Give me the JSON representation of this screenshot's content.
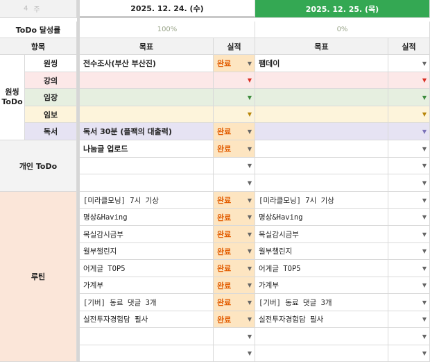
{
  "top_left": {
    "row_label": "4",
    "week_label": "주"
  },
  "dates": [
    "2025. 12. 24. (수)",
    "2025. 12. 25. (목)"
  ],
  "rate_label": "ToDo 달성률",
  "rates": [
    "100%",
    "0%"
  ],
  "headers": {
    "item": "항목",
    "goal": "목표",
    "result": "실적"
  },
  "groups": {
    "onssing": "원씽\nToDo",
    "personal": "개인 ToDo",
    "routine": "루틴"
  },
  "onssing_rows": [
    {
      "label": "원씽",
      "d1_goal": "전수조사(부산 부산진)",
      "d1_result": "완료",
      "d2_goal": "팸데이",
      "d2_result": ""
    },
    {
      "label": "강의",
      "d1_goal": "",
      "d1_result": "",
      "d2_goal": "",
      "d2_result": ""
    },
    {
      "label": "임장",
      "d1_goal": "",
      "d1_result": "",
      "d2_goal": "",
      "d2_result": ""
    },
    {
      "label": "임보",
      "d1_goal": "",
      "d1_result": "",
      "d2_goal": "",
      "d2_result": ""
    },
    {
      "label": "독서",
      "d1_goal": "독서 30분 (플팩의 대출력)",
      "d1_result": "완료",
      "d2_goal": "",
      "d2_result": ""
    }
  ],
  "personal_rows": [
    {
      "d1_goal": "나눔글 업로드",
      "d1_result": "완료",
      "d2_goal": "",
      "d2_result": ""
    },
    {
      "d1_goal": "",
      "d1_result": "",
      "d2_goal": "",
      "d2_result": ""
    },
    {
      "d1_goal": "",
      "d1_result": "",
      "d2_goal": "",
      "d2_result": ""
    }
  ],
  "routine_rows": [
    {
      "d1_goal": "[미라클모닝] 7시 기상",
      "d1_result": "완료",
      "d2_goal": "[미라클모닝] 7시 기상",
      "d2_result": ""
    },
    {
      "d1_goal": "명상&Having",
      "d1_result": "완료",
      "d2_goal": "명상&Having",
      "d2_result": ""
    },
    {
      "d1_goal": "목실감시금부",
      "d1_result": "완료",
      "d2_goal": "목실감시금부",
      "d2_result": ""
    },
    {
      "d1_goal": "월부챌린지",
      "d1_result": "완료",
      "d2_goal": "월부챌린지",
      "d2_result": ""
    },
    {
      "d1_goal": "어게글 TOP5",
      "d1_result": "완료",
      "d2_goal": "어게글 TOP5",
      "d2_result": ""
    },
    {
      "d1_goal": "가계부",
      "d1_result": "완료",
      "d2_goal": "가계부",
      "d2_result": ""
    },
    {
      "d1_goal": "[기버] 동료 댓글 3개",
      "d1_result": "완료",
      "d2_goal": "[기버] 동료 댓글 3개",
      "d2_result": ""
    },
    {
      "d1_goal": "실전투자경험담 필사",
      "d1_result": "완료",
      "d2_goal": "실전투자경험담 필사",
      "d2_result": ""
    },
    {
      "d1_goal": "",
      "d1_result": "",
      "d2_goal": "",
      "d2_result": ""
    },
    {
      "d1_goal": "",
      "d1_result": "",
      "d2_goal": "",
      "d2_result": ""
    }
  ],
  "colors": {
    "date2_header": "#34a853",
    "done_fill": "#fde5c1",
    "done_text": "#e25c00",
    "routine_fill": "#fbe6d9"
  }
}
